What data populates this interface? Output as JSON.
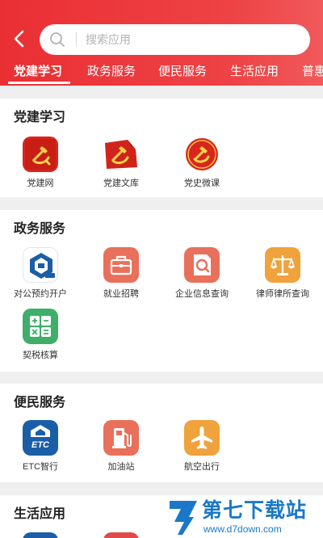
{
  "search": {
    "placeholder": "搜索应用"
  },
  "tabs": [
    "党建学习",
    "政务服务",
    "便民服务",
    "生活应用",
    "普惠"
  ],
  "sections": [
    {
      "title": "党建学习",
      "items": [
        "党建网",
        "党建文库",
        "党史微课"
      ]
    },
    {
      "title": "政务服务",
      "items": [
        "对公预约开户",
        "就业招聘",
        "企业信息查询",
        "律师律所查询",
        "契税核算"
      ]
    },
    {
      "title": "便民服务",
      "items": [
        "ETC智行",
        "加油站",
        "航空出行"
      ]
    },
    {
      "title": "生活应用",
      "items": []
    }
  ],
  "watermark": {
    "title": "第七下载站",
    "url": "www.d7down.com"
  },
  "colors": {
    "accent": "#ea2f33",
    "orange": "#f0a23c",
    "salmon": "#e9705a",
    "blue": "#1a5ea8",
    "green": "#3fae6a"
  }
}
